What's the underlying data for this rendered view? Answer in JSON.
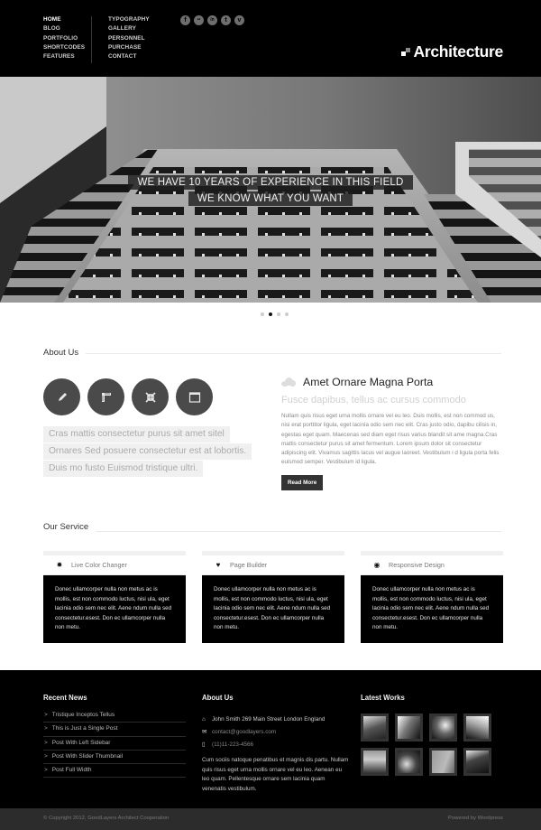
{
  "header": {
    "nav_primary": [
      "HOME",
      "BLOG",
      "PORTFOLIO",
      "SHORTCODES",
      "FEATURES"
    ],
    "nav_secondary": [
      "TYPOGRAPHY",
      "GALLERY",
      "PERSONNEL",
      "PURCHASE",
      "CONTACT"
    ],
    "active_item": "HOME",
    "social_icons": [
      {
        "name": "facebook-icon",
        "glyph": "f"
      },
      {
        "name": "flickr-icon",
        "glyph": "••"
      },
      {
        "name": "linkedin-icon",
        "glyph": "in"
      },
      {
        "name": "twitter-icon",
        "glyph": "t"
      },
      {
        "name": "vimeo-icon",
        "glyph": "v"
      }
    ],
    "logo_text": "Architecture"
  },
  "hero": {
    "caption_line_1": "WE HAVE 10 YEARS OF EXPERIENCE IN THIS FIELD",
    "caption_line_2": "WE KNOW WHAT YOU WANT",
    "slide_count": 4,
    "active_slide": 2
  },
  "about": {
    "section_title": "About Us",
    "icons": [
      "pencil-icon",
      "ruler-icon",
      "compress-icon",
      "window-icon"
    ],
    "quote_lines": [
      "Cras mattis consectetur purus sit amet sitel",
      "Ornares Sed posuere consectetur est at lobortis.",
      "Duis mo fusto Euismod tristique ultri."
    ],
    "right_title": "Amet Ornare Magna Porta",
    "right_subtitle": "Fusce dapibus, tellus ac cursus commodo",
    "right_body": "Nullam quis risus eget urna mollis ornare vel eu leo. Duis mollis, est non commod us, nisi erat porttitor ligula, eget lacinia odio sem nec elit. Cras justo odio, dapibu cilisis in, egestas eget quam. Maecenas sed diam eget risus varius blandit sit ame magna.Cras mattis consectetur purus sit amet fermentum. Lorem ipsum dolor sit consectetur adipiscing elit. Vivamus sagittis lacus vel augue laoreet. Vestibulum i d ligula porta felis euismod semper. Vestibulum id ligula.",
    "read_more_label": "Read More"
  },
  "services": {
    "section_title": "Our Service",
    "items": [
      {
        "title": "Live Color Changer",
        "icon": "✹",
        "body": "Donec ullamcorper nulla non metus ac is mollis, est non commodo luctus, nisi ula, eget lacinia odio sem nec elit. Aene ndum nulla sed consectetur.esest. Don ec ullamcorper nulla non metu."
      },
      {
        "title": "Page Builder",
        "icon": "♥",
        "body": "Donec ullamcorper nulla non metus ac is mollis, est non commodo luctus, nisi ula, eget lacinia odio sem nec elit. Aene ndum nulla sed consectetur.esest. Don ec ullamcorper nulla non metu."
      },
      {
        "title": "Responsive Design",
        "icon": "◉",
        "body": "Donec ullamcorper nulla non metus ac is mollis, est non commodo luctus, nisi ula, eget lacinia odio sem nec elit. Aene ndum nulla sed consectetur.esest. Don ec ullamcorper nulla non metu."
      }
    ]
  },
  "footer": {
    "recent_news_title": "Recent News",
    "recent_news": [
      "Tristique Inceptos Tellus",
      "This is Just a Single Post",
      "Post With Left Sidebar",
      "Post With Slider Thumbnail",
      "Post Full Width"
    ],
    "about_title": "About Us",
    "address": "John Smith 269 Main Street London England",
    "email": "contact@goodlayers.com",
    "phone": "(11)11-223-4566",
    "about_text": "Cum sociis natoque penatibus et magnis dis partu. Nullam quis risus eget urna mollis ornare vel eu leo. Aenean eu leo quam. Pellentesque ornare sem lacinia quam venenatis vestibulum.",
    "latest_works_title": "Latest Works",
    "latest_works_count": 8
  },
  "copyright": {
    "left": "© Copyright 2012, GoodLayers Architect Cooperation",
    "right": "Powered by Wordpress"
  }
}
